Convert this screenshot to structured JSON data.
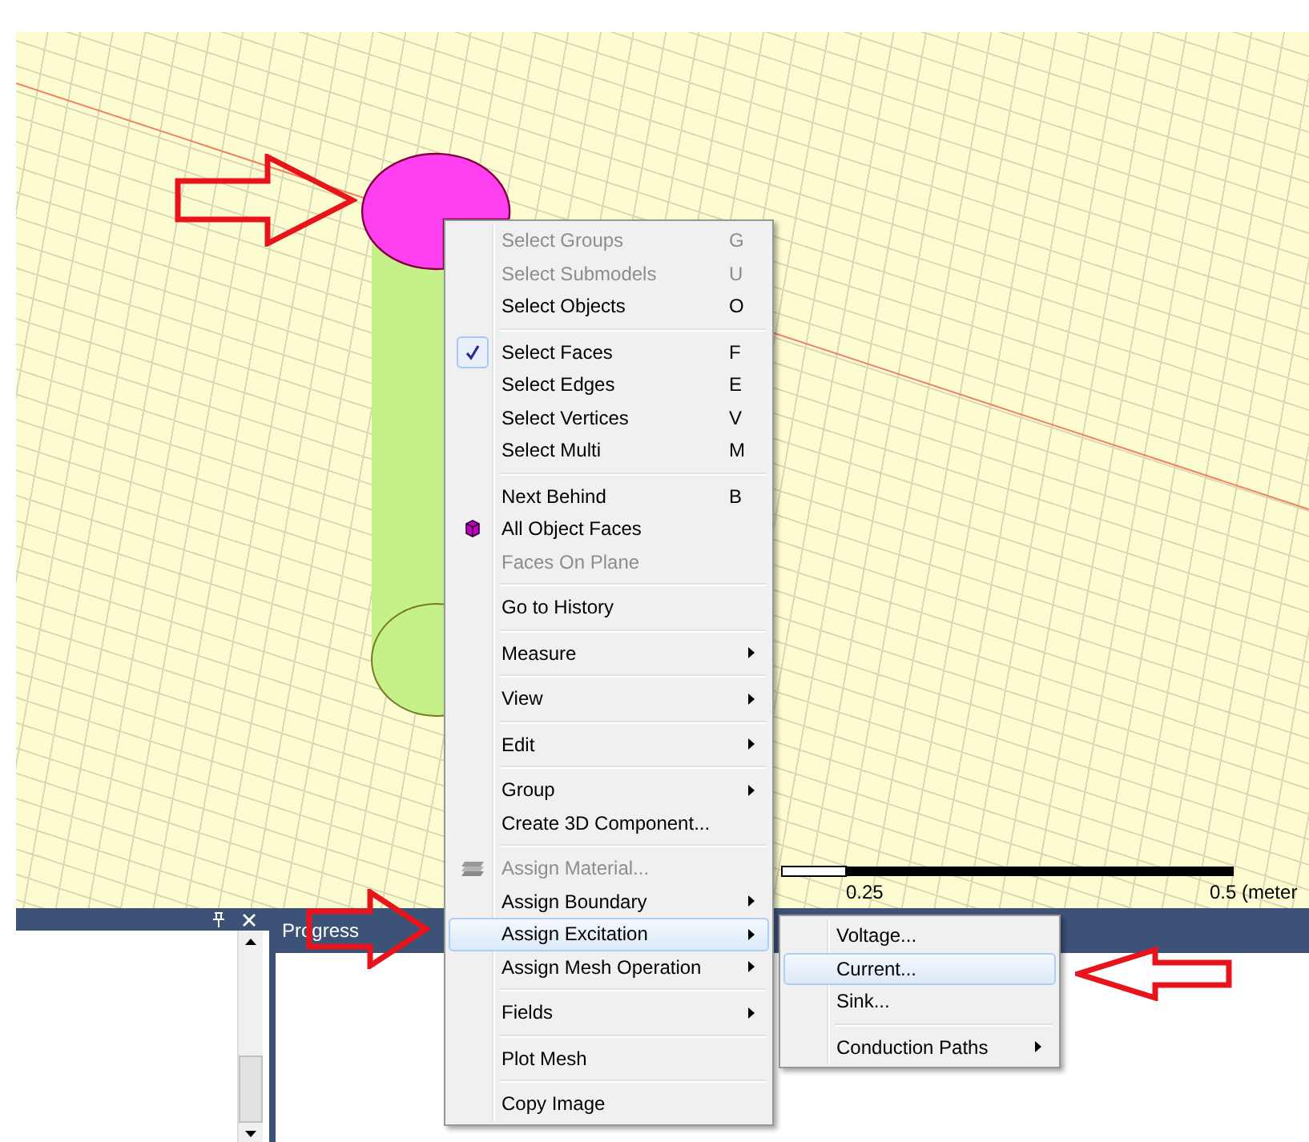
{
  "viewport": {
    "scale_labels": [
      "0.25",
      "0.5 (meter"
    ]
  },
  "bottom_panel": {
    "right_pane_title": "Progress"
  },
  "context_menu": {
    "groups": [
      {
        "items": [
          {
            "label": "Select Groups",
            "shortcut": "G",
            "kind": "item",
            "disabled": true,
            "checked": false,
            "selected": false,
            "submenu": false
          },
          {
            "label": "Select Submodels",
            "shortcut": "U",
            "kind": "item",
            "disabled": true,
            "checked": false,
            "selected": false,
            "submenu": false
          },
          {
            "label": "Select Objects",
            "shortcut": "O",
            "kind": "item",
            "disabled": false,
            "checked": false,
            "selected": false,
            "submenu": false
          }
        ]
      },
      {
        "items": [
          {
            "label": "Select Faces",
            "shortcut": "F",
            "kind": "item",
            "disabled": false,
            "checked": true,
            "selected": false,
            "submenu": false
          },
          {
            "label": "Select Edges",
            "shortcut": "E",
            "kind": "item",
            "disabled": false,
            "checked": false,
            "selected": false,
            "submenu": false
          },
          {
            "label": "Select Vertices",
            "shortcut": "V",
            "kind": "item",
            "disabled": false,
            "checked": false,
            "selected": false,
            "submenu": false
          },
          {
            "label": "Select Multi",
            "shortcut": "M",
            "kind": "item",
            "disabled": false,
            "checked": false,
            "selected": false,
            "submenu": false
          }
        ]
      },
      {
        "items": [
          {
            "label": "Next Behind",
            "shortcut": "B",
            "kind": "item",
            "disabled": false,
            "checked": false,
            "selected": false,
            "submenu": false
          },
          {
            "label": "All Object Faces",
            "kind": "object",
            "disabled": false,
            "checked": false,
            "selected": false,
            "submenu": false
          },
          {
            "label": "Faces On Plane",
            "kind": "item",
            "disabled": true,
            "checked": false,
            "selected": false,
            "submenu": false
          }
        ]
      },
      {
        "items": [
          {
            "label": "Go to History",
            "kind": "item",
            "disabled": false,
            "checked": false,
            "selected": false,
            "submenu": false
          }
        ]
      },
      {
        "items": [
          {
            "label": "Measure",
            "kind": "item",
            "disabled": false,
            "checked": false,
            "selected": false,
            "submenu": true
          }
        ]
      },
      {
        "items": [
          {
            "label": "View",
            "kind": "item",
            "disabled": false,
            "checked": false,
            "selected": false,
            "submenu": true
          }
        ]
      },
      {
        "items": [
          {
            "label": "Edit",
            "kind": "item",
            "disabled": false,
            "checked": false,
            "selected": false,
            "submenu": true
          }
        ]
      },
      {
        "items": [
          {
            "label": "Group",
            "kind": "item",
            "disabled": false,
            "checked": false,
            "selected": false,
            "submenu": true
          },
          {
            "label": "Create 3D Component...",
            "kind": "item",
            "disabled": false,
            "checked": false,
            "selected": false,
            "submenu": false
          }
        ]
      },
      {
        "items": [
          {
            "label": "Assign Material...",
            "kind": "material",
            "disabled": true,
            "checked": false,
            "selected": false,
            "submenu": false
          },
          {
            "label": "Assign Boundary",
            "kind": "item",
            "disabled": false,
            "checked": false,
            "selected": false,
            "submenu": true
          },
          {
            "label": "Assign Excitation",
            "kind": "item",
            "disabled": false,
            "checked": false,
            "selected": true,
            "submenu": true
          },
          {
            "label": "Assign Mesh Operation",
            "kind": "item",
            "disabled": false,
            "checked": false,
            "selected": false,
            "submenu": true
          }
        ]
      },
      {
        "items": [
          {
            "label": "Fields",
            "kind": "item",
            "disabled": false,
            "checked": false,
            "selected": false,
            "submenu": true
          }
        ]
      },
      {
        "items": [
          {
            "label": "Plot Mesh",
            "kind": "item",
            "disabled": false,
            "checked": false,
            "selected": false,
            "submenu": false
          }
        ]
      },
      {
        "items": [
          {
            "label": "Copy Image",
            "kind": "item",
            "disabled": false,
            "checked": false,
            "selected": false,
            "submenu": false
          }
        ]
      }
    ]
  },
  "submenu": {
    "groups": [
      {
        "items": [
          {
            "label": "Voltage...",
            "selected": false,
            "submenu": false
          },
          {
            "label": "Current...",
            "selected": true,
            "submenu": false
          },
          {
            "label": "Sink...",
            "selected": false,
            "submenu": false
          }
        ]
      },
      {
        "items": [
          {
            "label": "Conduction Paths",
            "selected": false,
            "submenu": true
          }
        ]
      }
    ]
  }
}
